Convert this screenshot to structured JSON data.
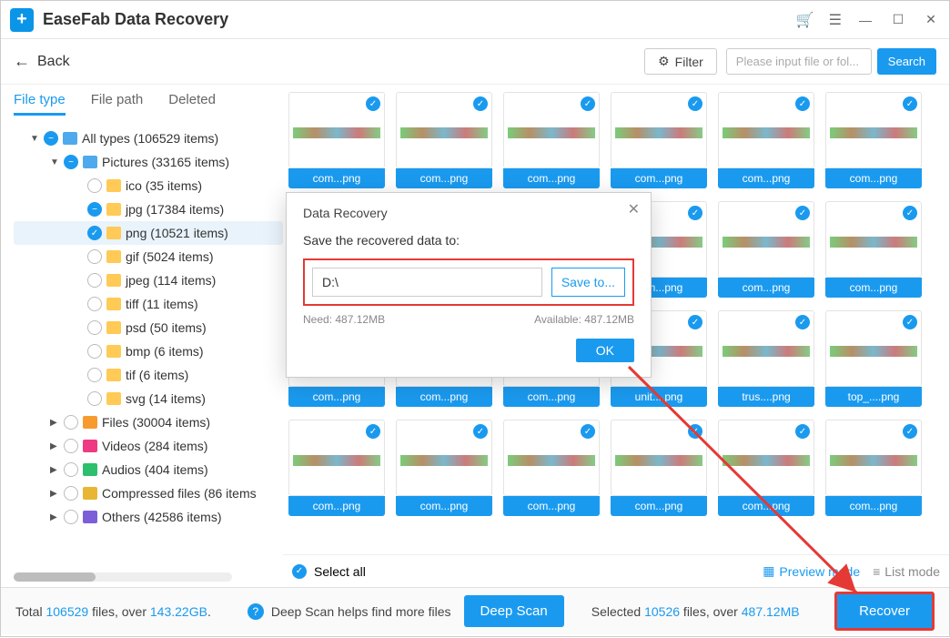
{
  "app": {
    "title": "EaseFab Data Recovery"
  },
  "toolbar": {
    "back": "Back",
    "filter": "Filter",
    "search_placeholder": "Please input file or fol...",
    "search_btn": "Search"
  },
  "tabs": {
    "t1": "File type",
    "t2": "File path",
    "t3": "Deleted"
  },
  "tree": {
    "all": "All types (106529 items)",
    "pictures": "Pictures (33165 items)",
    "ico": "ico (35 items)",
    "jpg": "jpg (17384 items)",
    "png": "png (10521 items)",
    "gif": "gif (5024 items)",
    "jpeg": "jpeg (114 items)",
    "tiff": "tiff (11 items)",
    "psd": "psd (50 items)",
    "bmp": "bmp (6 items)",
    "tif": "tif (6 items)",
    "svg": "svg (14 items)",
    "files": "Files (30004 items)",
    "videos": "Videos (284 items)",
    "audios": "Audios (404 items)",
    "compressed": "Compressed files (86 items",
    "others": "Others (42586 items)"
  },
  "grid": {
    "captions": [
      "com...png",
      "com...png",
      "com...png",
      "com...png",
      "com...png",
      "com...png",
      "com...png",
      "com...png",
      "com...png",
      "com...png",
      "com...png",
      "com...png",
      "com...png",
      "com...png",
      "com...png",
      "unit....png",
      "trus....png",
      "top_....png",
      "com...png",
      "com...png",
      "com...png",
      "com...png",
      "com...png",
      "com...png"
    ]
  },
  "content_bottom": {
    "select_all": "Select all",
    "preview": "Preview mode",
    "list": "List mode"
  },
  "modal": {
    "title": "Data Recovery",
    "sub": "Save the recovered data to:",
    "path": "D:\\",
    "saveto": "Save to...",
    "need_label": "Need:",
    "need_val": "487.12MB",
    "avail_label": "Available:",
    "avail_val": "487.12MB",
    "ok": "OK"
  },
  "status": {
    "total_pre": "Total ",
    "total_n": "106529",
    "total_mid": " files, over ",
    "total_size": "143.22GB",
    "total_suf": ".",
    "deep_hint": "Deep Scan helps find more files",
    "deep_btn": "Deep Scan",
    "sel_pre": "Selected ",
    "sel_n": "10526",
    "sel_mid": " files, over ",
    "sel_size": "487.12MB",
    "recover": "Recover"
  }
}
